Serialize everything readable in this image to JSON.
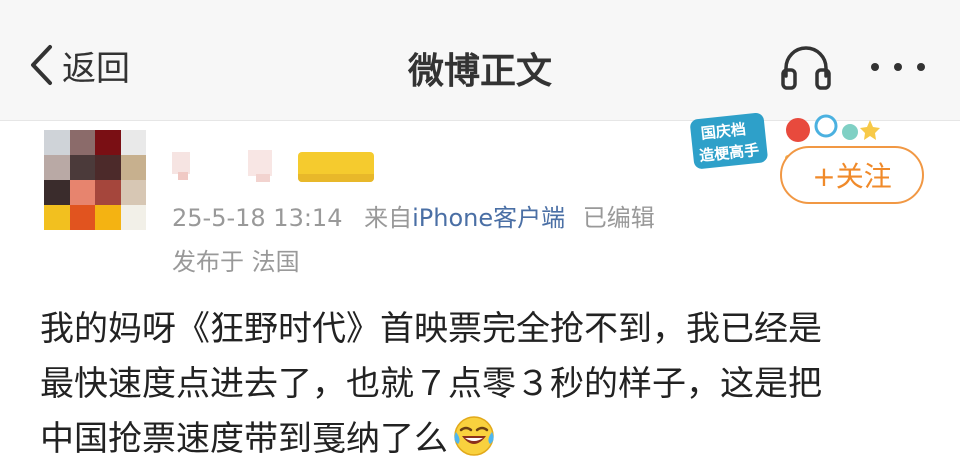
{
  "header": {
    "back_label": "返回",
    "title": "微博正文",
    "icons": [
      "chevron-left-icon",
      "headphone-icon",
      "more-icon"
    ]
  },
  "post": {
    "timestamp": "25-5-18 13:14",
    "source_prefix": "来自",
    "source_client": "iPhone客户端",
    "edited": "已编辑",
    "location": "发布于 法国",
    "follow_label": "+关注",
    "sticker_text": [
      "国庆档",
      "造梗高手"
    ],
    "lines": [
      "我的妈呀《狂野时代》首映票完全抢不到，我已经是",
      "最快速度点进去了，也就７点零３秒的样子，这是把",
      "中国抢票速度带到戛纳了么"
    ],
    "emoji": "laugh-cry-emoji"
  },
  "colors": {
    "header_bg": "#f7f7f7",
    "accent_orange": "#f08a2a",
    "link_blue": "#4a6fa5",
    "meta_gray": "#999999"
  }
}
